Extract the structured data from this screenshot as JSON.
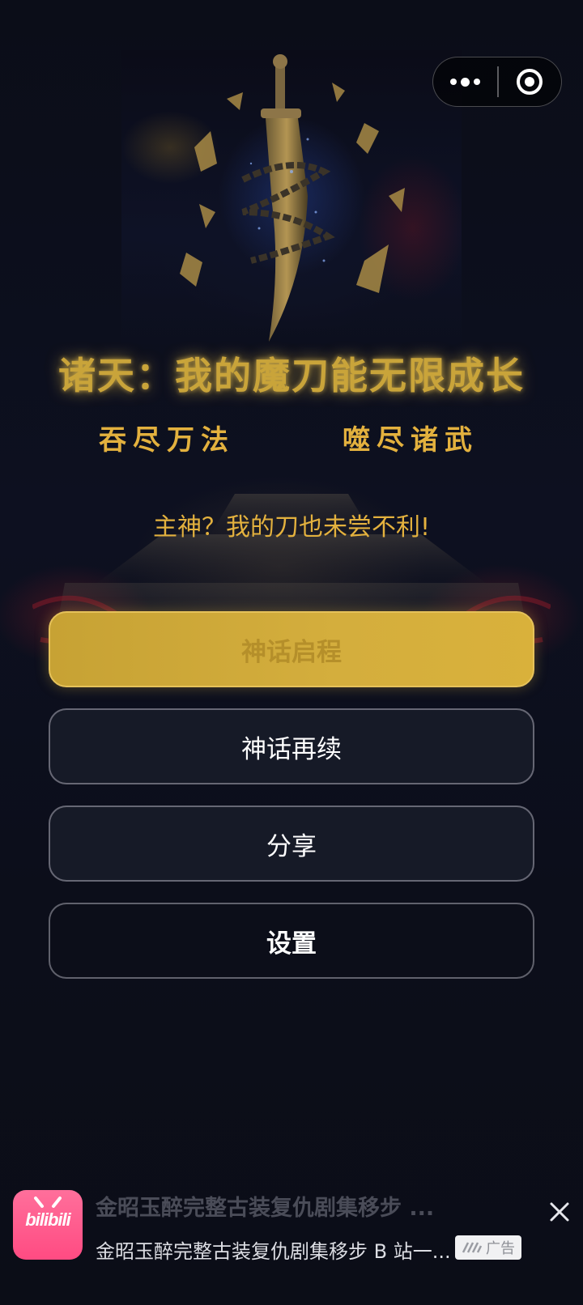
{
  "capsule": {
    "more_icon": "more-dots-icon",
    "close_icon": "mini-program-close-icon"
  },
  "hero": {
    "image": "sword-with-chains-and-runes"
  },
  "game": {
    "title": "诸天：我的魔刀能无限成长",
    "slogan_left": "吞尽万法",
    "slogan_right": "噬尽诸武",
    "subtitle": "主神？我的刀也未尝不利!"
  },
  "menu": {
    "start_label": "神话启程",
    "continue_label": "神话再续",
    "share_label": "分享",
    "settings_label": "设置"
  },
  "ad": {
    "logo_text": "bilibili",
    "title": "金昭玉醉完整古装复仇剧集移步 ...",
    "description": "金昭玉醉完整古装复仇剧集移步 B 站一...",
    "badge": "广告",
    "close_icon": "close-icon"
  },
  "colors": {
    "gold": "#e3b13e",
    "primary_button": "#d4ae3d",
    "background": "#0b0d17",
    "bilibili_pink": "#ff4b82"
  }
}
